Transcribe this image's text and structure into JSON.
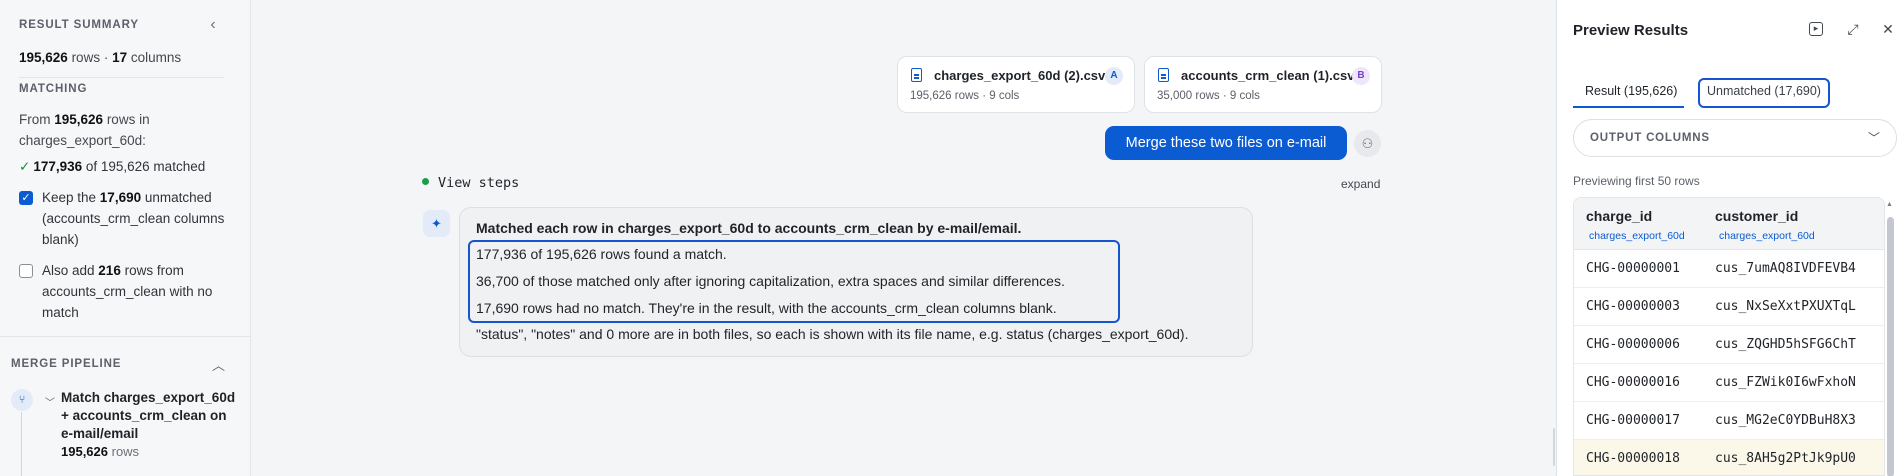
{
  "sidebar": {
    "result_summary": {
      "heading": "RESULT SUMMARY",
      "rows": "195,626",
      "rows_word": " rows · ",
      "columns": "17",
      "columns_word": " columns"
    },
    "matching": {
      "heading": "MATCHING",
      "from_prefix": "From ",
      "from_rows": "195,626",
      "from_suffix": " rows in charges_export_60d:",
      "matched_count": "177,936",
      "matched_suffix": " of 195,626 matched",
      "keep_prefix": "Keep the ",
      "keep_count": "17,690",
      "keep_suffix": " unmatched (accounts_crm_clean columns blank)",
      "keep_checked": true,
      "also_prefix": "Also add ",
      "also_count": "216",
      "also_suffix": " rows from accounts_crm_clean with no match",
      "also_checked": false
    },
    "merge_pipeline": {
      "heading": "MERGE PIPELINE",
      "step_label": "Match charges_export_60d + accounts_crm_clean on e-mail/email",
      "step_rows": "195,626",
      "step_rows_word": " rows"
    }
  },
  "chat": {
    "files": [
      {
        "name": "charges_export_60d (2).csv",
        "meta": "195,626 rows · 9 cols",
        "badge": "A",
        "badge_color": "#0b5bd3",
        "badge_bg": "#e3eaf8"
      },
      {
        "name": "accounts_crm_clean (1).csv",
        "meta": "35,000 rows · 9 cols",
        "badge": "B",
        "badge_color": "#7a3fd6",
        "badge_bg": "#efe6fb"
      }
    ],
    "user_message": "Merge these two files on e-mail",
    "view_steps": "View steps",
    "expand": "expand",
    "reply": {
      "title": "Matched each row in charges_export_60d to accounts_crm_clean by e-mail/email.",
      "lines": [
        "177,936 of 195,626 rows found a match.",
        "36,700 of those matched only after ignoring capitalization, extra spaces and similar differences.",
        "17,690 rows had no match. They're in the result, with the accounts_crm_clean columns blank.",
        "\"status\", \"notes\" and 0 more are in both files, so each is shown with its file name, e.g. status (charges_export_60d)."
      ]
    }
  },
  "preview": {
    "title": "Preview Results",
    "tabs": [
      {
        "label": "Result (195,626)"
      },
      {
        "label": "Unmatched (17,690)"
      }
    ],
    "output_columns": "OUTPUT COLUMNS",
    "note": "Previewing first 50 rows",
    "columns": [
      {
        "name": "charge_id",
        "source": "charges_export_60d"
      },
      {
        "name": "customer_id",
        "source": "charges_export_60d"
      }
    ],
    "rows": [
      [
        "CHG-00000001",
        "cus_7umAQ8IVDFEVB4"
      ],
      [
        "CHG-00000003",
        "cus_NxSeXxtPXUXTqL"
      ],
      [
        "CHG-00000006",
        "cus_ZQGHD5hSFG6ChT"
      ],
      [
        "CHG-00000016",
        "cus_FZWik0I6wFxhoN"
      ],
      [
        "CHG-00000017",
        "cus_MG2eC0YDBuH8X3"
      ],
      [
        "CHG-00000018",
        "cus_8AH5g2PtJk9pU0"
      ]
    ]
  }
}
